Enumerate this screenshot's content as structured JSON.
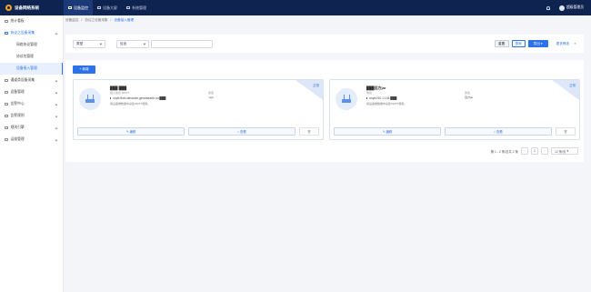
{
  "app": {
    "title": "设备网络系统",
    "user": "超级管理员"
  },
  "topnav": [
    {
      "label": "设备监控",
      "active": true
    },
    {
      "label": "设备大屏",
      "active": false
    },
    {
      "label": "系统管理",
      "active": false
    }
  ],
  "sidebar": [
    {
      "label": "统计看板"
    },
    {
      "label": "协议之设备采集",
      "open": true
    },
    {
      "label": "网络协议管理",
      "sub": true
    },
    {
      "label": "协议包管理",
      "sub": true
    },
    {
      "label": "设备接入管理",
      "sub": true,
      "selected": true
    },
    {
      "label": "通道类设备采集"
    },
    {
      "label": "设备管理"
    },
    {
      "label": "告警中心"
    },
    {
      "label": "告警规则"
    },
    {
      "label": "规则引擎"
    },
    {
      "label": "运维管理"
    }
  ],
  "breadcrumb": [
    "设备监控",
    "协议之设备采集",
    "设备接入管理"
  ],
  "filters": {
    "field1": "类型",
    "field2": "包含",
    "reset": "重置",
    "search": "搜索",
    "export": "导出",
    "more": "更多筛选"
  },
  "add_button": "+ 新增",
  "cards": [
    {
      "status": "正常",
      "name": "███ ███",
      "tag": "接入协议:MQTT",
      "address": "mqtt://iotc.devcode.geovisearth.co:███",
      "desc": "用设备端数据中采集MQTT服务。",
      "k1": "类型",
      "k2": "mqtt",
      "edit": "编辑",
      "view": "查看",
      "del": ""
    },
    {
      "status": "正常",
      "name": "███远方jar",
      "tag": "协议",
      "address": "mqtt://10.1.104.███",
      "desc": "用设备端数据中采集MQTT服务。",
      "k1": "类型",
      "k2": "远方jar",
      "edit": "编辑",
      "view": "查看",
      "del": ""
    }
  ],
  "pagination": {
    "summary": "第 1 - 2 条/总共 2 条",
    "current": "1",
    "page_size": "12 条/页"
  }
}
